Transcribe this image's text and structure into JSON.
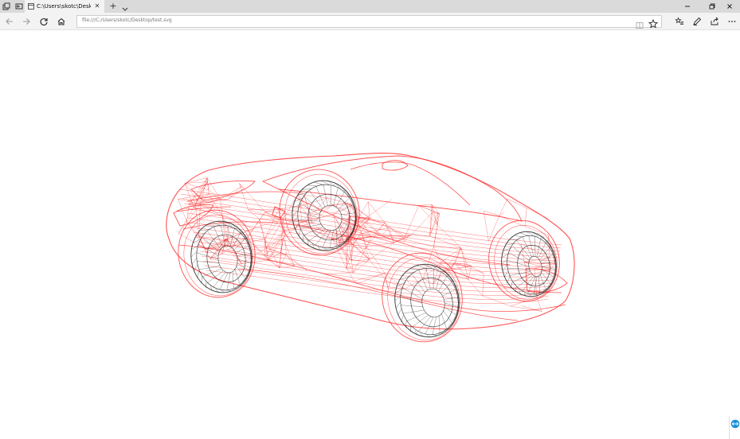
{
  "browser": {
    "tab": {
      "title": "C:\\Users\\skotc\\Desktop"
    },
    "address": {
      "url": "file:///C:/Users/skotc/Desktop/test.svg"
    }
  },
  "colors": {
    "titlebar": "#dadada",
    "toolbar": "#f3f3f3",
    "wireframe_red": "#ff1a1a",
    "wireframe_black": "#1a1a1a",
    "side_widget_blue": "#1a8fd8"
  },
  "icons": {
    "tab_actions": "tab-preview-icon",
    "set_aside": "set-aside-tabs-icon",
    "reading_view": "reading-view-icon",
    "favorite": "star-icon",
    "favorites_hub": "favorites-hub-icon",
    "notes": "web-note-icon",
    "share": "share-icon",
    "more": "more-icon"
  }
}
